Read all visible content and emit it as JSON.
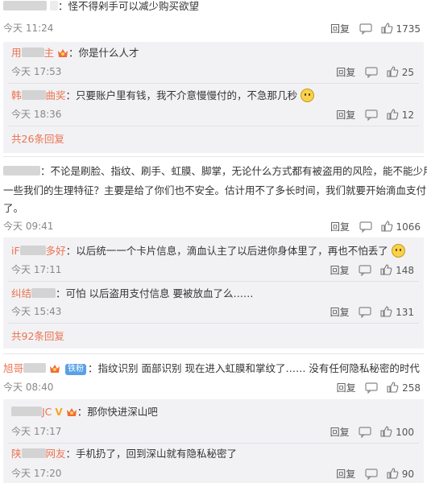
{
  "comments": [
    {
      "name": "",
      "text": "怪不得剁手可以减少购买欲望",
      "time": "今天 11:24",
      "reply_label": "回复",
      "likes": "1735"
    },
    {
      "name": "",
      "text": "不论是刷脸、指纹、刷手、虹膜、脚掌，无论什么方式都有被盗用的风险，能不能少用",
      "text_line2": "一些我们的生理特征？主要是给了你们也不安全。估计用不了多长时间，我们就要开始滴血支付",
      "text_line3": "了。",
      "time": "今天 09:41",
      "reply_label": "回复",
      "likes": "1066"
    },
    {
      "name": "旭哥",
      "badge": "铁粉",
      "text": "指纹识别 面部识别 现在进入虹膜和掌纹了……  没有任何隐私秘密的时代",
      "time": "今天 08:40",
      "reply_label": "回复",
      "likes": "258"
    }
  ],
  "replies": [
    {
      "name": "用",
      "name_suffix": "主",
      "text": "你是什么人才",
      "time": "今天 17:53",
      "reply_label": "回复",
      "likes": "25"
    },
    {
      "name": "韩",
      "name_suffix": "曲奖",
      "text": "只要账户里有钱，我不介意慢慢付的，不急那几秒",
      "time": "今天 18:36",
      "reply_label": "回复",
      "likes": "12"
    },
    {
      "name": "iF",
      "name_suffix": "多好",
      "text": "以后统一一个卡片信息，滴血认主了以后进你身体里了，再也不怕丢了",
      "time": "今天 17:11",
      "reply_label": "回复",
      "likes": "148"
    },
    {
      "name": "纠结",
      "name_suffix": "",
      "text": "可怕 以后盗用支付信息 要被放血了么……",
      "time": "今天 15:43",
      "reply_label": "回复",
      "likes": "131"
    },
    {
      "name": "",
      "name_suffix": "JC",
      "text": "那你快进深山吧",
      "time": "今天 17:17",
      "reply_label": "回复",
      "likes": "100"
    },
    {
      "name": "陕",
      "name_suffix": "网友",
      "text": "手机扔了，回到深山就有隐私秘密了",
      "time": "今天 17:20",
      "reply_label": "回复",
      "likes": "90"
    }
  ],
  "more_links": [
    "共26条回复",
    "共92条回复"
  ],
  "colors": {
    "accent": "#eb7350",
    "reply_bg": "#f2f2f5",
    "badge": "#5aa0e6"
  }
}
